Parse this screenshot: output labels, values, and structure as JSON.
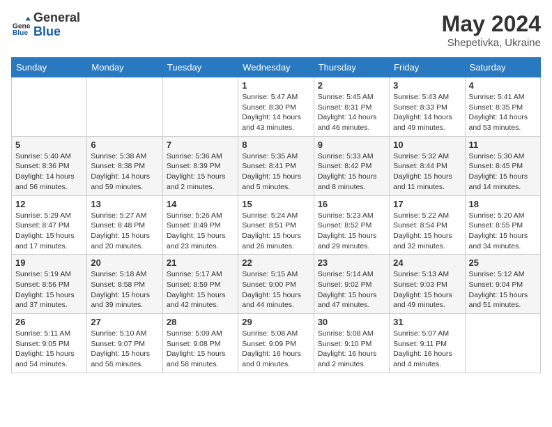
{
  "header": {
    "logo": {
      "general": "General",
      "blue": "Blue"
    },
    "month_year": "May 2024",
    "location": "Shepetivka, Ukraine"
  },
  "weekdays": [
    "Sunday",
    "Monday",
    "Tuesday",
    "Wednesday",
    "Thursday",
    "Friday",
    "Saturday"
  ],
  "weeks": [
    [
      {
        "day": "",
        "sunrise": "",
        "sunset": "",
        "daylight": ""
      },
      {
        "day": "",
        "sunrise": "",
        "sunset": "",
        "daylight": ""
      },
      {
        "day": "",
        "sunrise": "",
        "sunset": "",
        "daylight": ""
      },
      {
        "day": "1",
        "sunrise": "Sunrise: 5:47 AM",
        "sunset": "Sunset: 8:30 PM",
        "daylight": "Daylight: 14 hours and 43 minutes."
      },
      {
        "day": "2",
        "sunrise": "Sunrise: 5:45 AM",
        "sunset": "Sunset: 8:31 PM",
        "daylight": "Daylight: 14 hours and 46 minutes."
      },
      {
        "day": "3",
        "sunrise": "Sunrise: 5:43 AM",
        "sunset": "Sunset: 8:33 PM",
        "daylight": "Daylight: 14 hours and 49 minutes."
      },
      {
        "day": "4",
        "sunrise": "Sunrise: 5:41 AM",
        "sunset": "Sunset: 8:35 PM",
        "daylight": "Daylight: 14 hours and 53 minutes."
      }
    ],
    [
      {
        "day": "5",
        "sunrise": "Sunrise: 5:40 AM",
        "sunset": "Sunset: 8:36 PM",
        "daylight": "Daylight: 14 hours and 56 minutes."
      },
      {
        "day": "6",
        "sunrise": "Sunrise: 5:38 AM",
        "sunset": "Sunset: 8:38 PM",
        "daylight": "Daylight: 14 hours and 59 minutes."
      },
      {
        "day": "7",
        "sunrise": "Sunrise: 5:36 AM",
        "sunset": "Sunset: 8:39 PM",
        "daylight": "Daylight: 15 hours and 2 minutes."
      },
      {
        "day": "8",
        "sunrise": "Sunrise: 5:35 AM",
        "sunset": "Sunset: 8:41 PM",
        "daylight": "Daylight: 15 hours and 5 minutes."
      },
      {
        "day": "9",
        "sunrise": "Sunrise: 5:33 AM",
        "sunset": "Sunset: 8:42 PM",
        "daylight": "Daylight: 15 hours and 8 minutes."
      },
      {
        "day": "10",
        "sunrise": "Sunrise: 5:32 AM",
        "sunset": "Sunset: 8:44 PM",
        "daylight": "Daylight: 15 hours and 11 minutes."
      },
      {
        "day": "11",
        "sunrise": "Sunrise: 5:30 AM",
        "sunset": "Sunset: 8:45 PM",
        "daylight": "Daylight: 15 hours and 14 minutes."
      }
    ],
    [
      {
        "day": "12",
        "sunrise": "Sunrise: 5:29 AM",
        "sunset": "Sunset: 8:47 PM",
        "daylight": "Daylight: 15 hours and 17 minutes."
      },
      {
        "day": "13",
        "sunrise": "Sunrise: 5:27 AM",
        "sunset": "Sunset: 8:48 PM",
        "daylight": "Daylight: 15 hours and 20 minutes."
      },
      {
        "day": "14",
        "sunrise": "Sunrise: 5:26 AM",
        "sunset": "Sunset: 8:49 PM",
        "daylight": "Daylight: 15 hours and 23 minutes."
      },
      {
        "day": "15",
        "sunrise": "Sunrise: 5:24 AM",
        "sunset": "Sunset: 8:51 PM",
        "daylight": "Daylight: 15 hours and 26 minutes."
      },
      {
        "day": "16",
        "sunrise": "Sunrise: 5:23 AM",
        "sunset": "Sunset: 8:52 PM",
        "daylight": "Daylight: 15 hours and 29 minutes."
      },
      {
        "day": "17",
        "sunrise": "Sunrise: 5:22 AM",
        "sunset": "Sunset: 8:54 PM",
        "daylight": "Daylight: 15 hours and 32 minutes."
      },
      {
        "day": "18",
        "sunrise": "Sunrise: 5:20 AM",
        "sunset": "Sunset: 8:55 PM",
        "daylight": "Daylight: 15 hours and 34 minutes."
      }
    ],
    [
      {
        "day": "19",
        "sunrise": "Sunrise: 5:19 AM",
        "sunset": "Sunset: 8:56 PM",
        "daylight": "Daylight: 15 hours and 37 minutes."
      },
      {
        "day": "20",
        "sunrise": "Sunrise: 5:18 AM",
        "sunset": "Sunset: 8:58 PM",
        "daylight": "Daylight: 15 hours and 39 minutes."
      },
      {
        "day": "21",
        "sunrise": "Sunrise: 5:17 AM",
        "sunset": "Sunset: 8:59 PM",
        "daylight": "Daylight: 15 hours and 42 minutes."
      },
      {
        "day": "22",
        "sunrise": "Sunrise: 5:15 AM",
        "sunset": "Sunset: 9:00 PM",
        "daylight": "Daylight: 15 hours and 44 minutes."
      },
      {
        "day": "23",
        "sunrise": "Sunrise: 5:14 AM",
        "sunset": "Sunset: 9:02 PM",
        "daylight": "Daylight: 15 hours and 47 minutes."
      },
      {
        "day": "24",
        "sunrise": "Sunrise: 5:13 AM",
        "sunset": "Sunset: 9:03 PM",
        "daylight": "Daylight: 15 hours and 49 minutes."
      },
      {
        "day": "25",
        "sunrise": "Sunrise: 5:12 AM",
        "sunset": "Sunset: 9:04 PM",
        "daylight": "Daylight: 15 hours and 51 minutes."
      }
    ],
    [
      {
        "day": "26",
        "sunrise": "Sunrise: 5:11 AM",
        "sunset": "Sunset: 9:05 PM",
        "daylight": "Daylight: 15 hours and 54 minutes."
      },
      {
        "day": "27",
        "sunrise": "Sunrise: 5:10 AM",
        "sunset": "Sunset: 9:07 PM",
        "daylight": "Daylight: 15 hours and 56 minutes."
      },
      {
        "day": "28",
        "sunrise": "Sunrise: 5:09 AM",
        "sunset": "Sunset: 9:08 PM",
        "daylight": "Daylight: 15 hours and 58 minutes."
      },
      {
        "day": "29",
        "sunrise": "Sunrise: 5:08 AM",
        "sunset": "Sunset: 9:09 PM",
        "daylight": "Daylight: 16 hours and 0 minutes."
      },
      {
        "day": "30",
        "sunrise": "Sunrise: 5:08 AM",
        "sunset": "Sunset: 9:10 PM",
        "daylight": "Daylight: 16 hours and 2 minutes."
      },
      {
        "day": "31",
        "sunrise": "Sunrise: 5:07 AM",
        "sunset": "Sunset: 9:11 PM",
        "daylight": "Daylight: 16 hours and 4 minutes."
      },
      {
        "day": "",
        "sunrise": "",
        "sunset": "",
        "daylight": ""
      }
    ]
  ]
}
